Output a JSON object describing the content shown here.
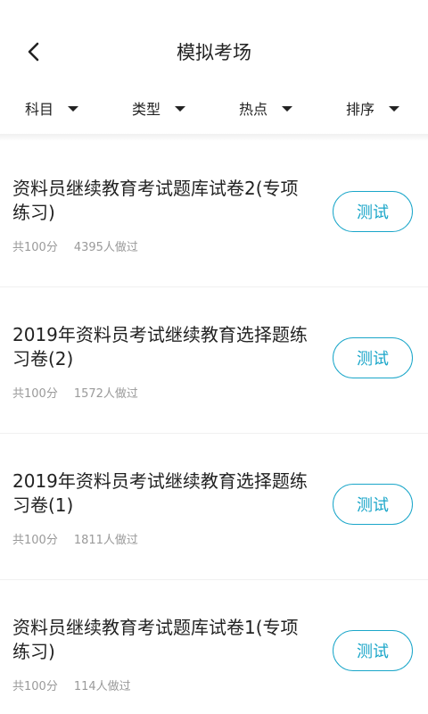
{
  "header": {
    "title": "模拟考场"
  },
  "filters": [
    {
      "label": "科目"
    },
    {
      "label": "类型"
    },
    {
      "label": "热点"
    },
    {
      "label": "排序"
    }
  ],
  "items": [
    {
      "title": "资料员继续教育考试题库试卷2(专项练习)",
      "score": "共100分",
      "count": "4395人做过",
      "button": "测试"
    },
    {
      "title": "2019年资料员考试继续教育选择题练习卷(2)",
      "score": "共100分",
      "count": "1572人做过",
      "button": "测试"
    },
    {
      "title": "2019年资料员考试继续教育选择题练习卷(1)",
      "score": "共100分",
      "count": "1811人做过",
      "button": "测试"
    },
    {
      "title": "资料员继续教育考试题库试卷1(专项练习)",
      "score": "共100分",
      "count": "114人做过",
      "button": "测试"
    }
  ],
  "colors": {
    "accent": "#1aa6c9",
    "muted": "#9a9a9a",
    "text": "#222222"
  },
  "icons": {
    "back": "chevron-left-icon",
    "dropdown": "caret-down-icon"
  }
}
